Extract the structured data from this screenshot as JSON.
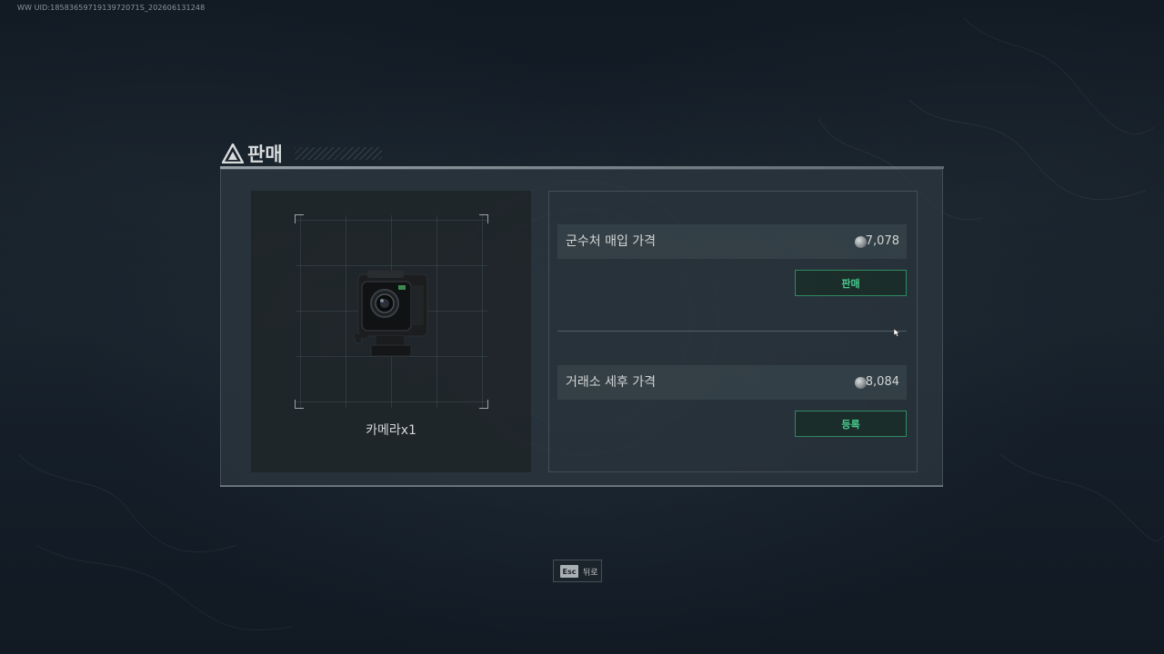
{
  "debug": {
    "uid_text": "WW UID:1858365971913972071S_202606131248"
  },
  "dialog": {
    "title": "판매",
    "title_icon": "warning-triangle-icon"
  },
  "item": {
    "name": "카메라x1",
    "image_icon": "action-camera-icon"
  },
  "prices": {
    "vendor": {
      "label": "군수처 매입 가격",
      "value": "7,078",
      "currency_icon": "silver-coin-icon",
      "button_label": "판매"
    },
    "exchange": {
      "label": "거래소 세후 가격",
      "value": "8,084",
      "currency_icon": "silver-coin-icon",
      "button_label": "등록"
    }
  },
  "footer": {
    "esc_key": "Esc",
    "esc_label": "뒤로"
  },
  "colors": {
    "accent_green": "#46c98c",
    "button_border": "#2f8a62",
    "background": "#121a24"
  }
}
